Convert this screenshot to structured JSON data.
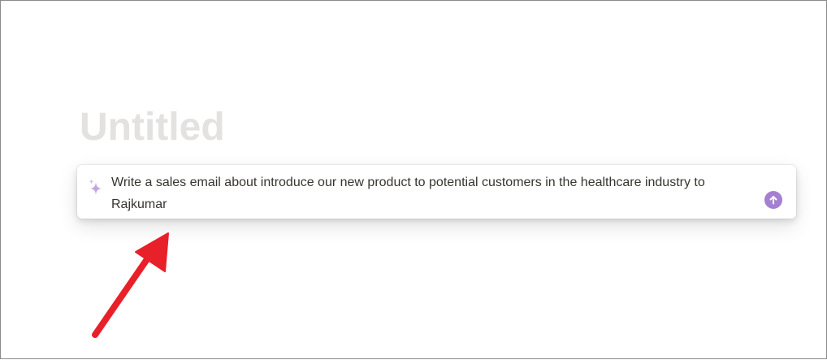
{
  "page": {
    "title": "Untitled"
  },
  "ai_prompt": {
    "text": "Write a sales email about introduce our new product to potential customers in the healthcare industry to Rajkumar",
    "sparkle_icon": "sparkle-icon",
    "submit_icon": "arrow-up-icon"
  },
  "annotation": {
    "icon": "red-arrow-icon"
  },
  "colors": {
    "title_placeholder": "#e3e2e0",
    "text": "#37352f",
    "accent_purple": "#a57fd0",
    "sparkle": "#c3a6e0",
    "arrow_red": "#e8202a"
  }
}
